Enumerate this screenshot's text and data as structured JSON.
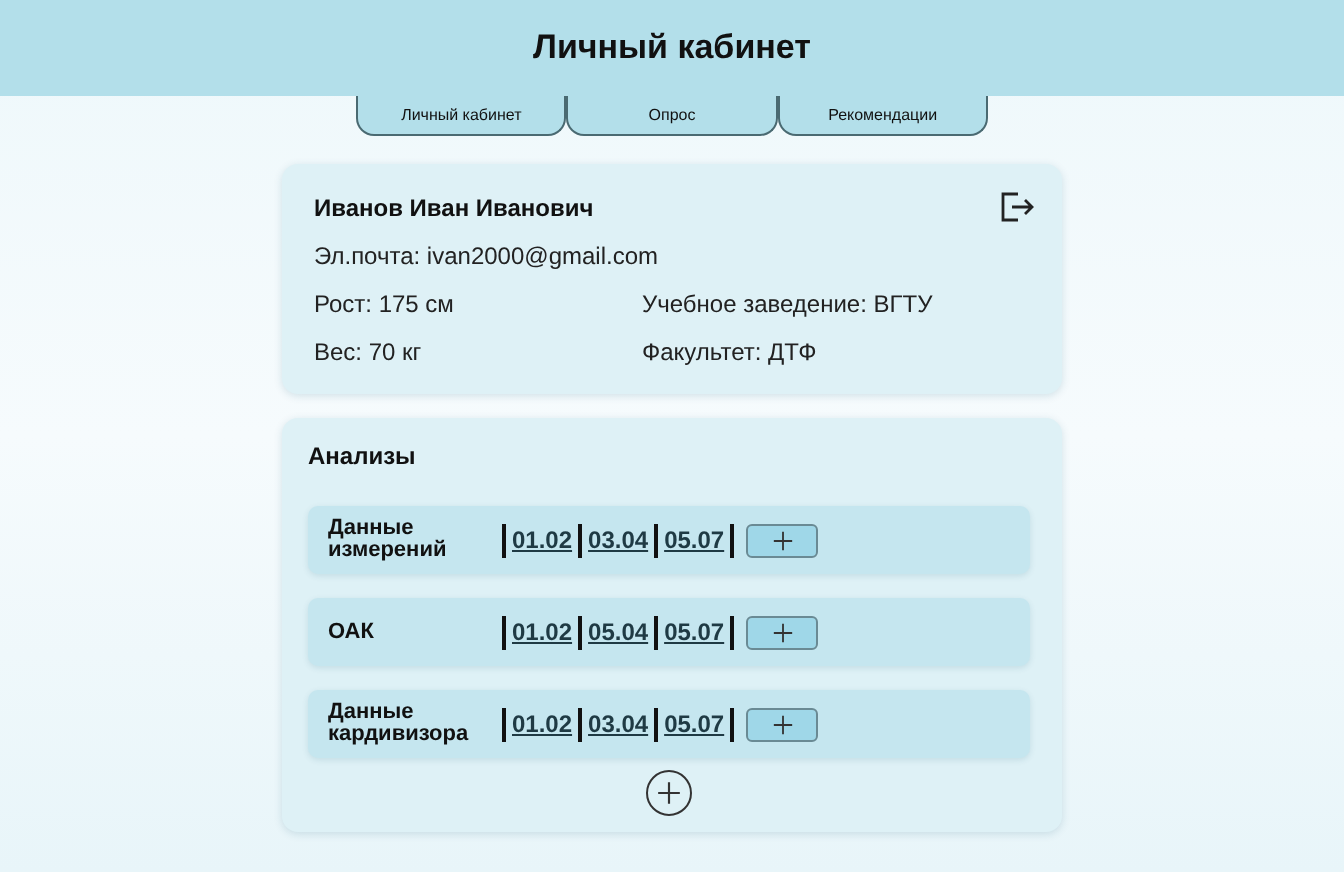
{
  "header": {
    "title": "Личный кабинет"
  },
  "tabs": [
    {
      "label": "Личный кабинет"
    },
    {
      "label": "Опрос"
    },
    {
      "label": "Рекомендации"
    }
  ],
  "profile": {
    "name": "Иванов Иван Иванович",
    "email": "Эл.почта: ivan2000@gmail.com",
    "height": "Рост: 175 см",
    "school": "Учебное заведение: ВГТУ",
    "weight": "Вес: 70 кг",
    "faculty": "Факультет: ДТФ"
  },
  "analyses": {
    "title": "Анализы",
    "rows": [
      {
        "label": "Данные измерений",
        "dates": [
          "01.02",
          "03.04",
          "05.07"
        ]
      },
      {
        "label": "ОАК",
        "dates": [
          "01.02",
          "05.04",
          "05.07"
        ]
      },
      {
        "label": "Данные кардивизора",
        "dates": [
          "01.02",
          "03.04",
          "05.07"
        ]
      }
    ]
  }
}
